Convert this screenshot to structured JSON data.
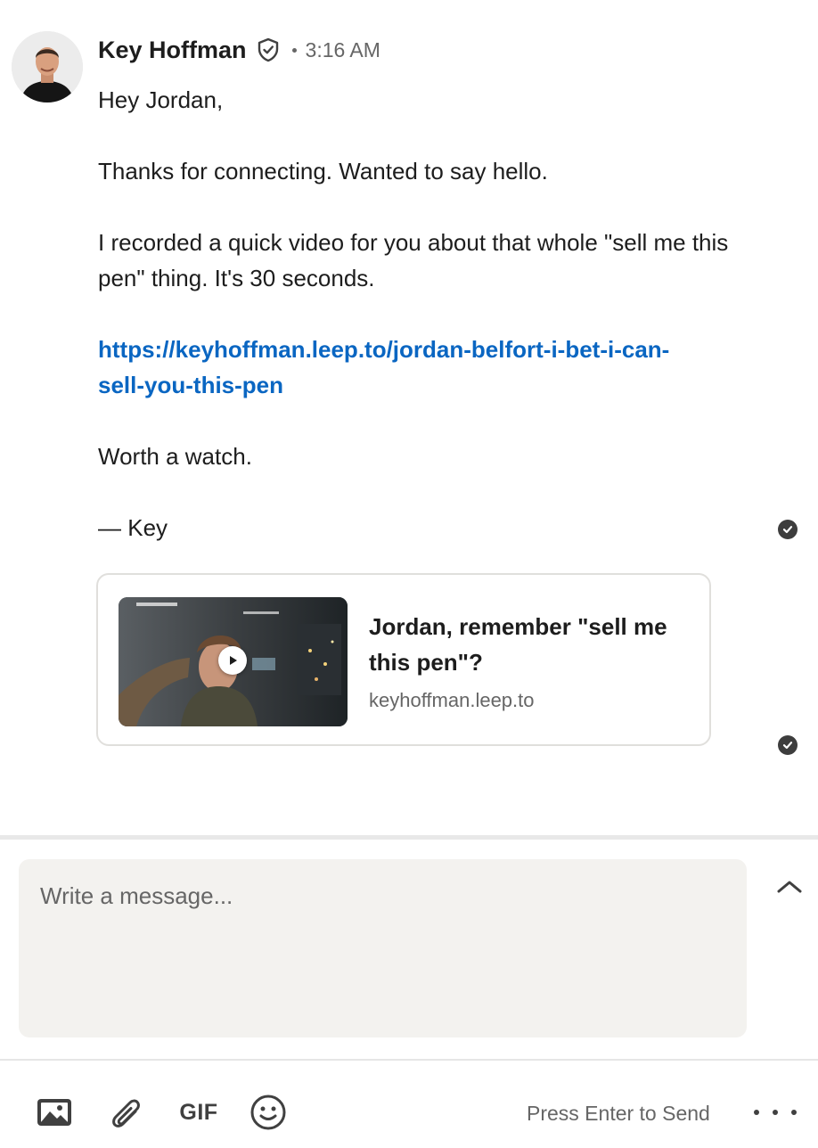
{
  "message": {
    "sender_name": "Key Hoffman",
    "separator": "·",
    "timestamp": "3:16 AM",
    "greeting": "Hey Jordan,",
    "line_1": "Thanks for connecting. Wanted to say hello.",
    "line_2": "I recorded a quick video for you about that whole \"sell me this pen\" thing. It's 30 seconds.",
    "link": "https://keyhoffman.leep.to/jordan-belfort-i-bet-i-can-sell-you-this-pen",
    "line_3": "Worth a watch.",
    "signoff": "— Key"
  },
  "link_preview": {
    "title": "Jordan, remember \"sell me this pen\"?",
    "domain": "keyhoffman.leep.to"
  },
  "composer": {
    "placeholder": "Write a message...",
    "gif_label": "GIF",
    "send_hint": "Press Enter to Send"
  },
  "icons": {
    "verified": "shield-check-icon",
    "read_receipt": "check-circle-icon",
    "expand": "chevron-up-icon",
    "image": "image-icon",
    "attach": "paperclip-icon",
    "emoji": "smiley-icon",
    "more": "ellipsis-icon"
  },
  "colors": {
    "link": "#0a66c2",
    "composer_bg": "#f3f2ef",
    "text": "#1d1d1d",
    "muted": "#666666"
  }
}
